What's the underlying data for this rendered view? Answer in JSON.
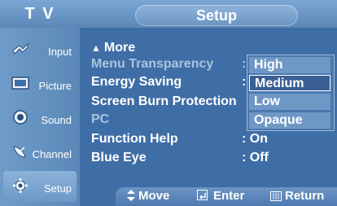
{
  "header": {
    "tv_label": "T V",
    "section_title": "Setup"
  },
  "sidebar": {
    "items": [
      {
        "label": "Input",
        "icon": "input-plug-icon"
      },
      {
        "label": "Picture",
        "icon": "picture-icon"
      },
      {
        "label": "Sound",
        "icon": "speaker-icon"
      },
      {
        "label": "Channel",
        "icon": "satellite-dish-icon"
      },
      {
        "label": "Setup",
        "icon": "gear-icon"
      }
    ],
    "active": "Setup"
  },
  "menu": {
    "more_label": "More",
    "rows": [
      {
        "label": "Menu Transparency",
        "value": ":",
        "enabled": true
      },
      {
        "label": "Energy Saving",
        "value": ":",
        "enabled": true
      },
      {
        "label": "Screen Burn Protection",
        "value": "",
        "enabled": true
      },
      {
        "label": "PC",
        "value": "",
        "enabled": false
      },
      {
        "label": "Function Help",
        "value": ": On",
        "enabled": true
      },
      {
        "label": "Blue Eye",
        "value": ": Off",
        "enabled": true
      }
    ]
  },
  "dropdown": {
    "options": [
      "High",
      "Medium",
      "Low",
      "Opaque"
    ],
    "selected": "Medium"
  },
  "footer": {
    "move_label": "Move",
    "enter_label": "Enter",
    "return_label": "Return"
  },
  "colors": {
    "panel_bg": "#3f6ea6",
    "sidebar_bg": "#6e9bc8",
    "selected_option_bg": "#3a5f94"
  }
}
